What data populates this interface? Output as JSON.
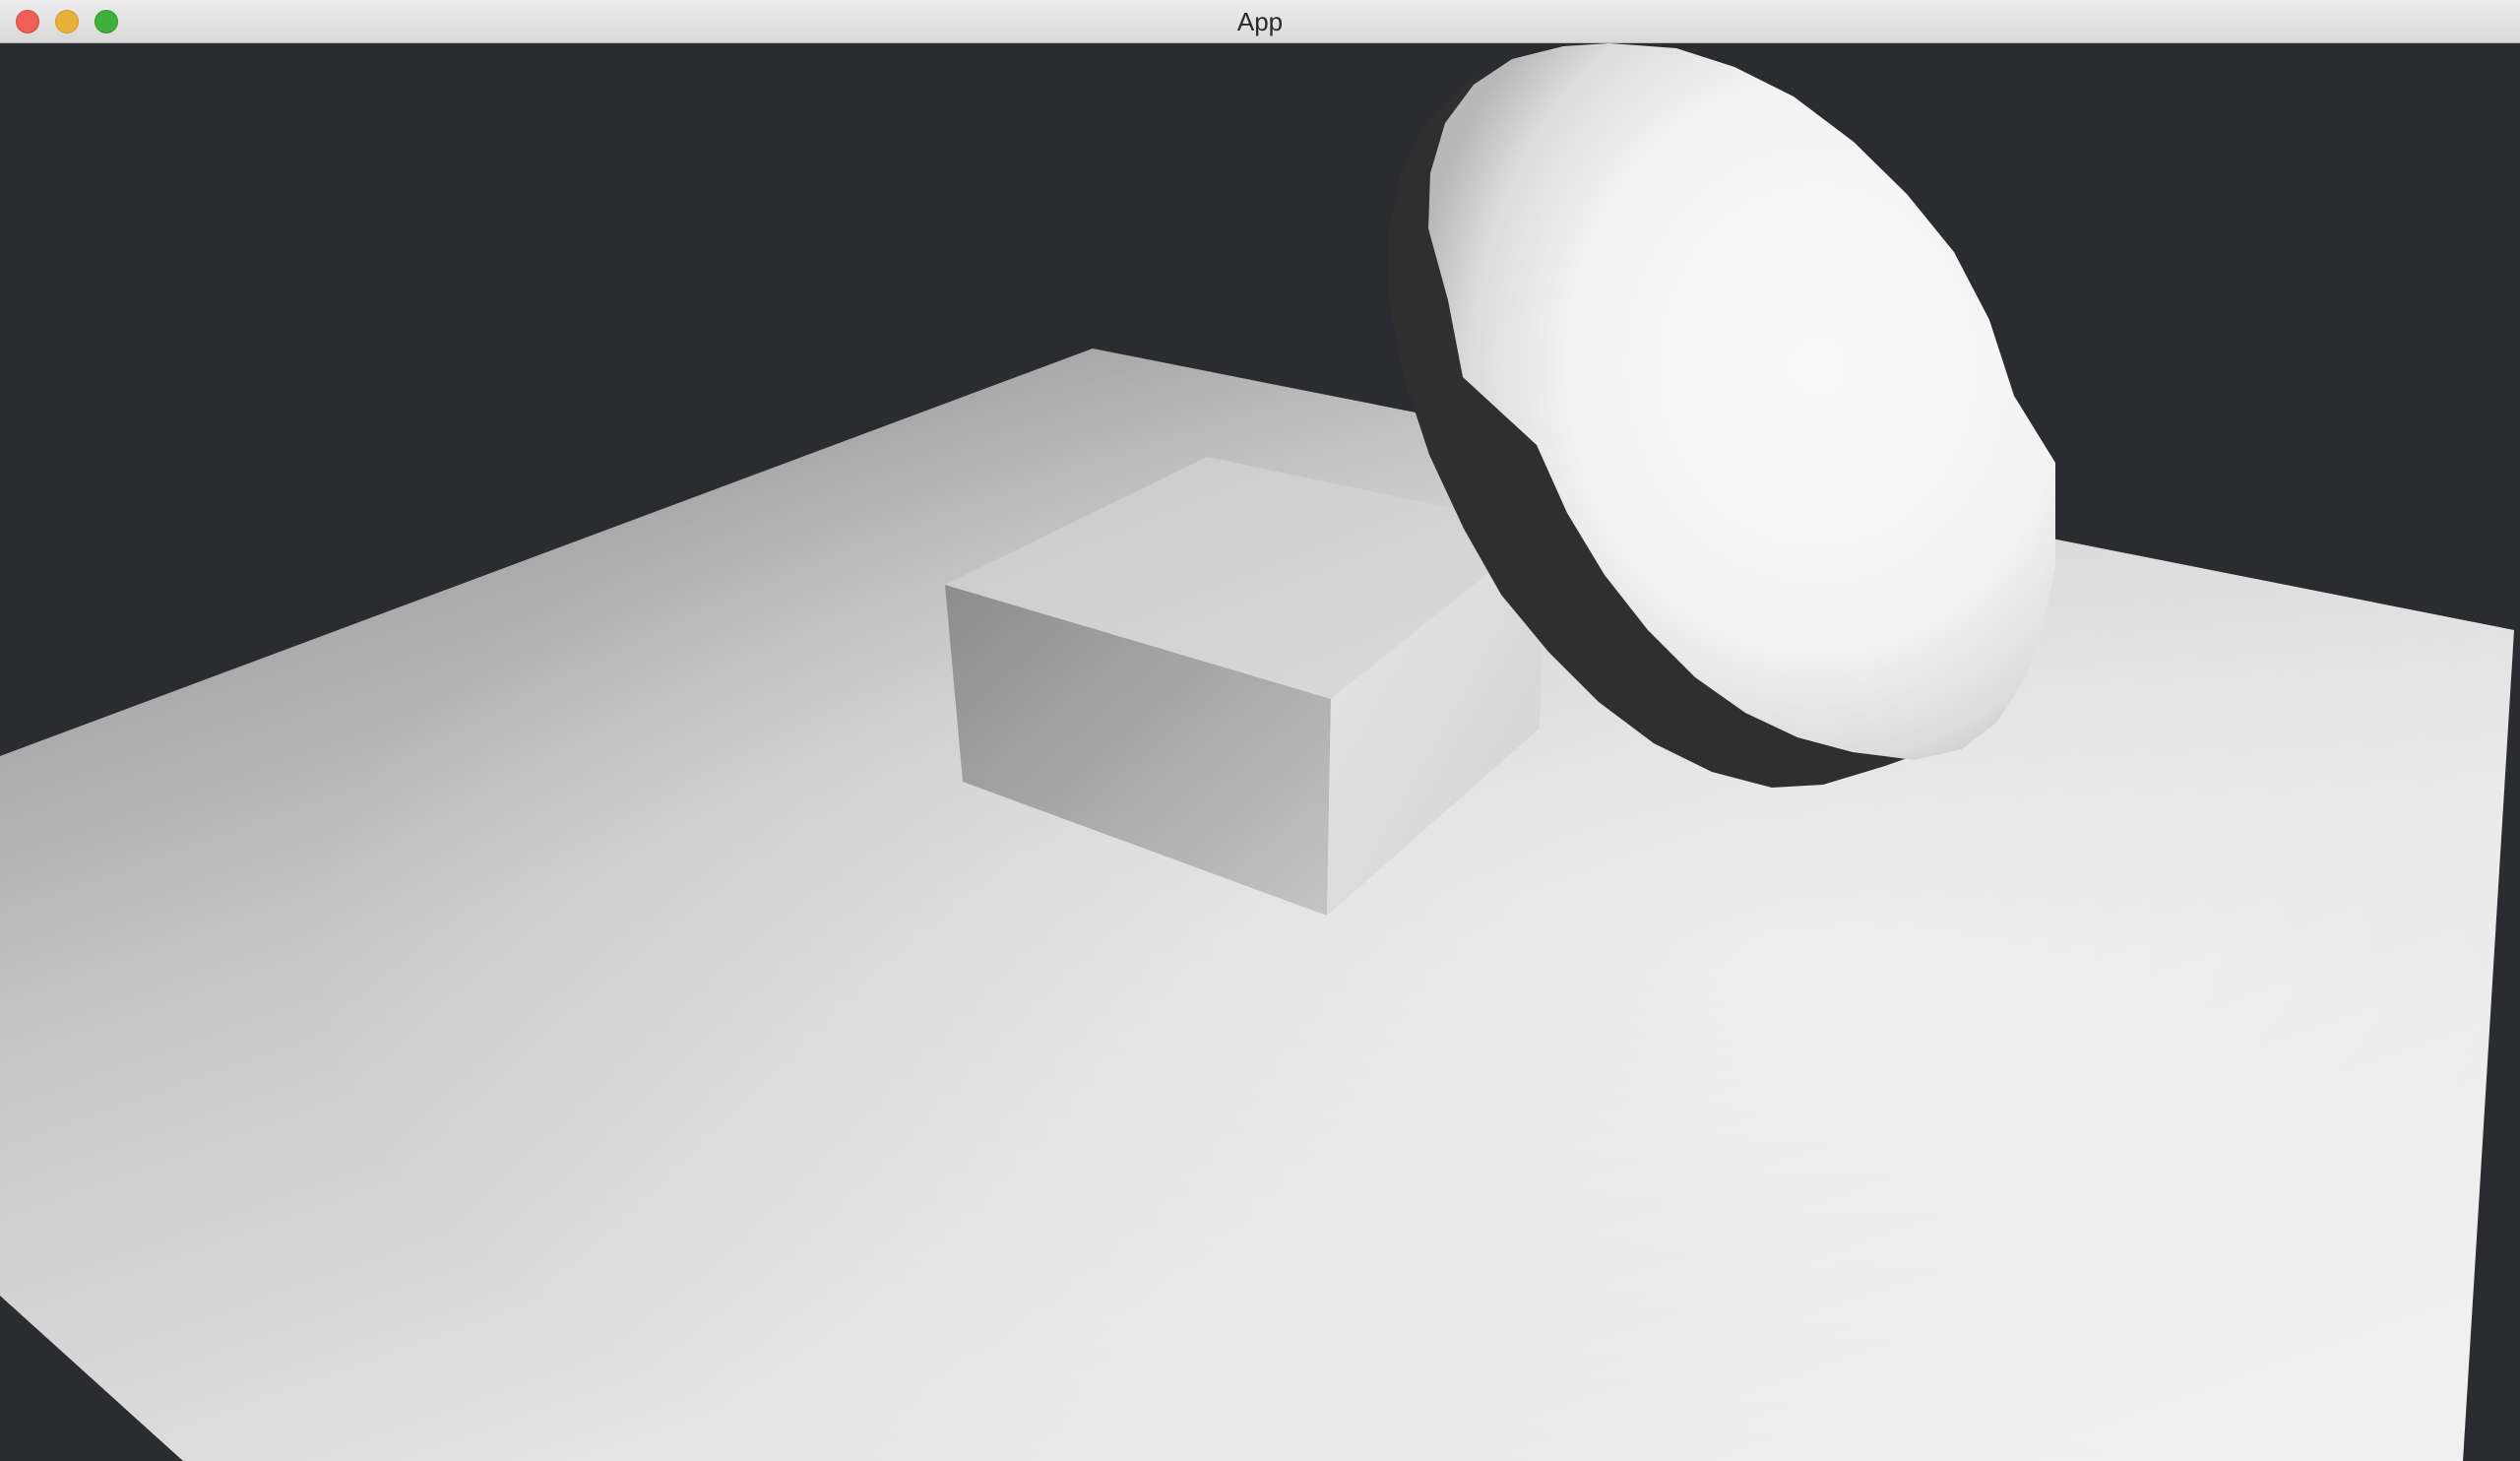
{
  "window": {
    "title": "App"
  },
  "titlebar": {
    "buttons": [
      {
        "name": "close-button",
        "color": "#ed5f57"
      },
      {
        "name": "minimize-button",
        "color": "#e8b13a"
      },
      {
        "name": "zoom-button",
        "color": "#3fae3a"
      }
    ]
  },
  "scene": {
    "background_color": "#2b2c30",
    "objects": [
      "ground-plane",
      "box",
      "sphere"
    ]
  }
}
